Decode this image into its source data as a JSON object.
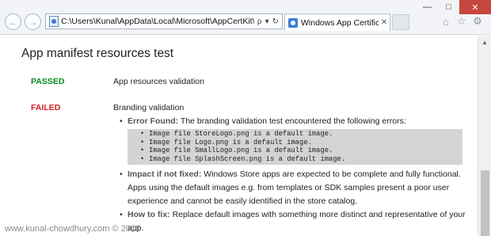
{
  "browser": {
    "address": "C:\\Users\\Kunal\\AppData\\Local\\Microsoft\\AppCertKit\\test.htm",
    "tab_title": "Windows App Certification ...",
    "tools": {
      "search": "ρ",
      "dropdown": "▾",
      "refresh": "↻"
    },
    "window_buttons": {
      "minimize": "—",
      "maximize": "□",
      "close": "✕"
    }
  },
  "page": {
    "title": "App manifest resources test",
    "tests": [
      {
        "status": "PASSED",
        "name": "App resources validation"
      },
      {
        "status": "FAILED",
        "name": "Branding validation"
      }
    ],
    "error_found_label": "Error Found:",
    "error_found_text": " The branding validation test encountered the following errors:",
    "errors": [
      "Image file StoreLogo.png is a default image.",
      "Image file Logo.png is a default image.",
      "Image file SmallLogo.png is a default image.",
      "Image file SplashScreen.png is a default image."
    ],
    "impact_label": "Impact if not fixed:",
    "impact_text": " Windows Store apps are expected to be complete and fully functional. Apps using the default images e.g. from templates or SDK samples present a poor user experience and cannot be easily identified in the store catalog.",
    "howto_label": "How to fix:",
    "howto_text": " Replace default images with something more distinct and representative of your app."
  },
  "watermark": "www.kunal-chowdhury.com © 2012",
  "colors": {
    "passed": "#0a8a1e",
    "failed": "#d81e2a",
    "close_button": "#c7463d"
  }
}
